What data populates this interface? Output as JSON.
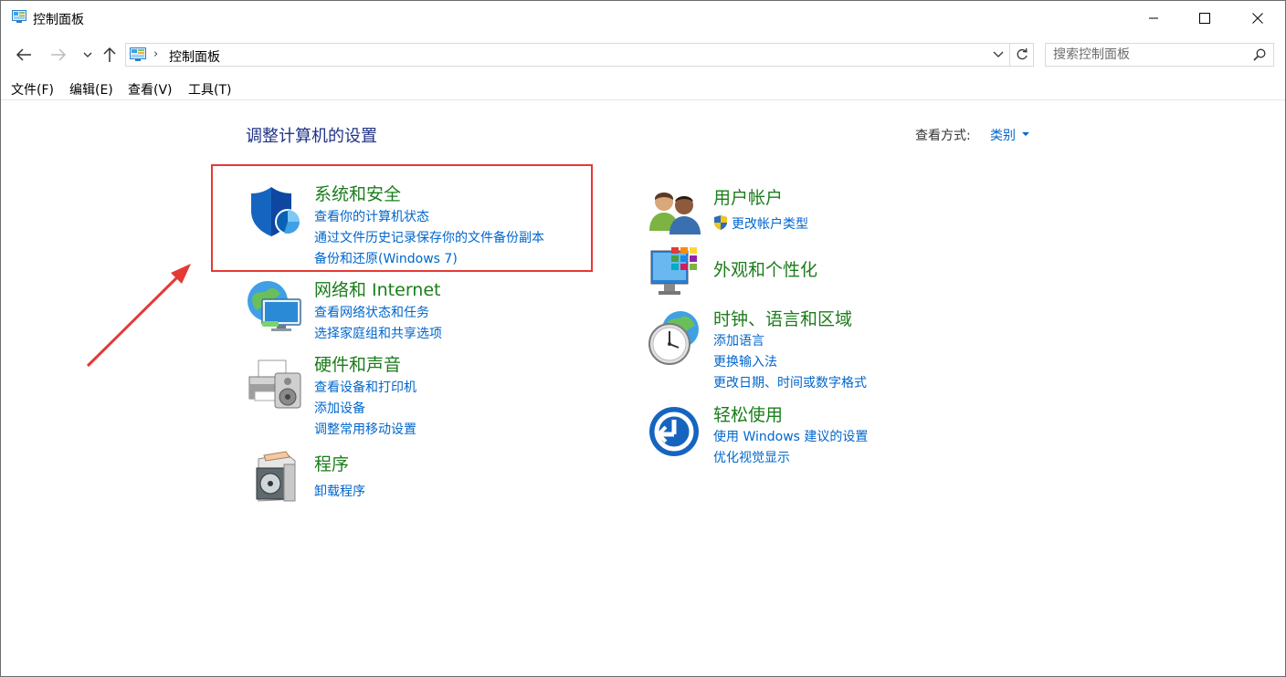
{
  "window": {
    "title": "控制面板",
    "minimize_glyph": "─",
    "maximize_glyph": "☐",
    "close_glyph": "✕"
  },
  "address_bar": {
    "separator": "›",
    "breadcrumb": "控制面板"
  },
  "search": {
    "placeholder": "搜索控制面板"
  },
  "menu": {
    "file": "文件(F)",
    "edit": "编辑(E)",
    "view": "查看(V)",
    "tools": "工具(T)"
  },
  "content": {
    "heading": "调整计算机的设置",
    "view_by_label": "查看方式:",
    "view_by_value": "类别"
  },
  "left_categories": [
    {
      "title": "系统和安全",
      "icon": "shield-icon",
      "links": [
        "查看你的计算机状态",
        "通过文件历史记录保存你的文件备份副本",
        "备份和还原(Windows 7)"
      ]
    },
    {
      "title": "网络和 Internet",
      "icon": "network-icon",
      "links": [
        "查看网络状态和任务",
        "选择家庭组和共享选项"
      ]
    },
    {
      "title": "硬件和声音",
      "icon": "printer-icon",
      "links": [
        "查看设备和打印机",
        "添加设备",
        "调整常用移动设置"
      ]
    },
    {
      "title": "程序",
      "icon": "programs-icon",
      "links": [
        "卸载程序"
      ]
    }
  ],
  "right_categories": [
    {
      "title": "用户帐户",
      "icon": "users-icon",
      "links": [
        "更改帐户类型"
      ]
    },
    {
      "title": "外观和个性化",
      "icon": "appearance-icon",
      "links": []
    },
    {
      "title": "时钟、语言和区域",
      "icon": "clock-globe-icon",
      "links": [
        "添加语言",
        "更换输入法",
        "更改日期、时间或数字格式"
      ]
    },
    {
      "title": "轻松使用",
      "icon": "ease-of-access-icon",
      "links": [
        "使用 Windows 建议的设置",
        "优化视觉显示"
      ]
    }
  ],
  "colors": {
    "category_title": "#1b7d1b",
    "link": "#0066cc",
    "heading": "#1e3287",
    "annotation": "#e53935"
  }
}
